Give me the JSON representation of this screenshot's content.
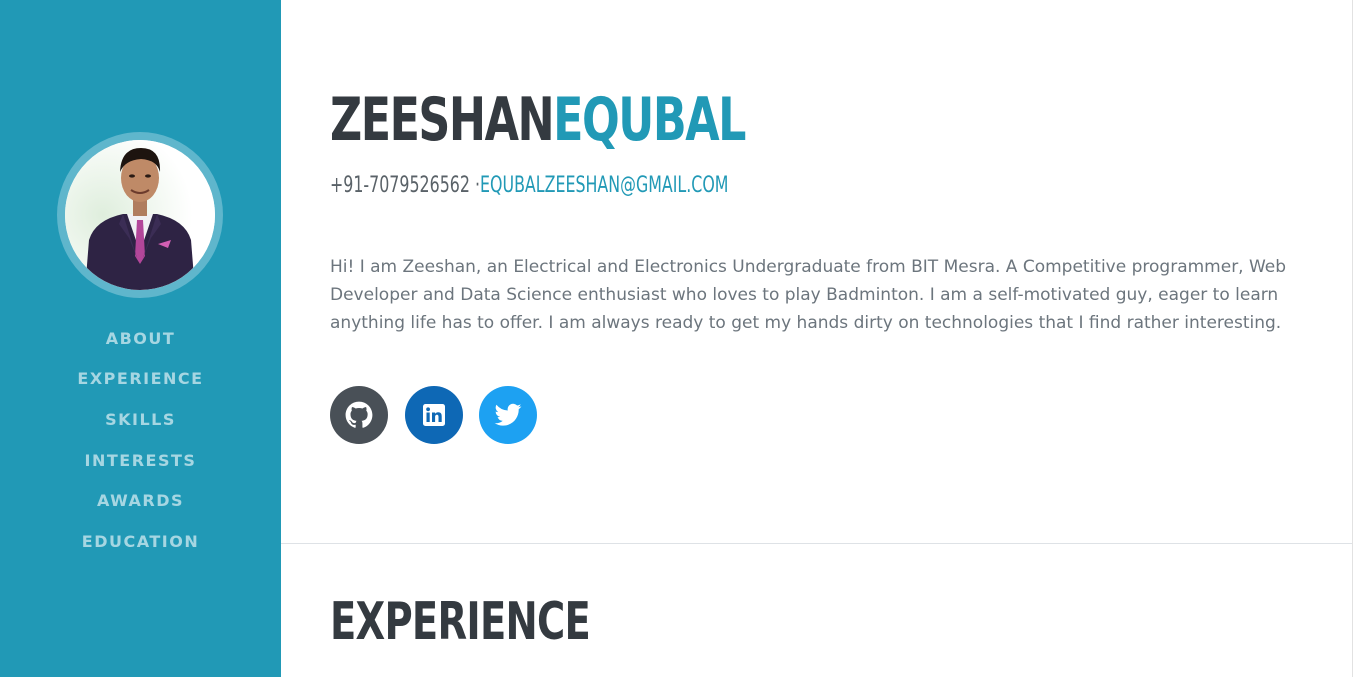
{
  "sidebar": {
    "background": "#2199b6",
    "nav": [
      {
        "label": "ABOUT"
      },
      {
        "label": "EXPERIENCE"
      },
      {
        "label": "SKILLS"
      },
      {
        "label": "INTERESTS"
      },
      {
        "label": "AWARDS"
      },
      {
        "label": "EDUCATION"
      }
    ]
  },
  "header": {
    "first_name": "ZEESHAN",
    "last_name": "EQUBAL",
    "phone": "+91-7079526562 ·",
    "email": "EQUBALZEESHAN@GMAIL.COM"
  },
  "about": {
    "bio": "Hi! I am Zeeshan, an Electrical and Electronics Undergraduate from BIT Mesra. A Competitive programmer, Web Developer and Data Science enthusiast who loves to play Badminton. I am a self-motivated guy, eager to learn anything life has to offer. I am always ready to get my hands dirty on technologies that I find rather interesting."
  },
  "social": [
    {
      "icon": "github-icon",
      "color": "#495057"
    },
    {
      "icon": "linkedin-icon",
      "color": "#0e68b5"
    },
    {
      "icon": "twitter-icon",
      "color": "#1da1f2"
    }
  ],
  "experience": {
    "title": "EXPERIENCE"
  },
  "colors": {
    "accent": "#2199b6",
    "heading": "#343a40",
    "body_text": "#6c757d"
  }
}
